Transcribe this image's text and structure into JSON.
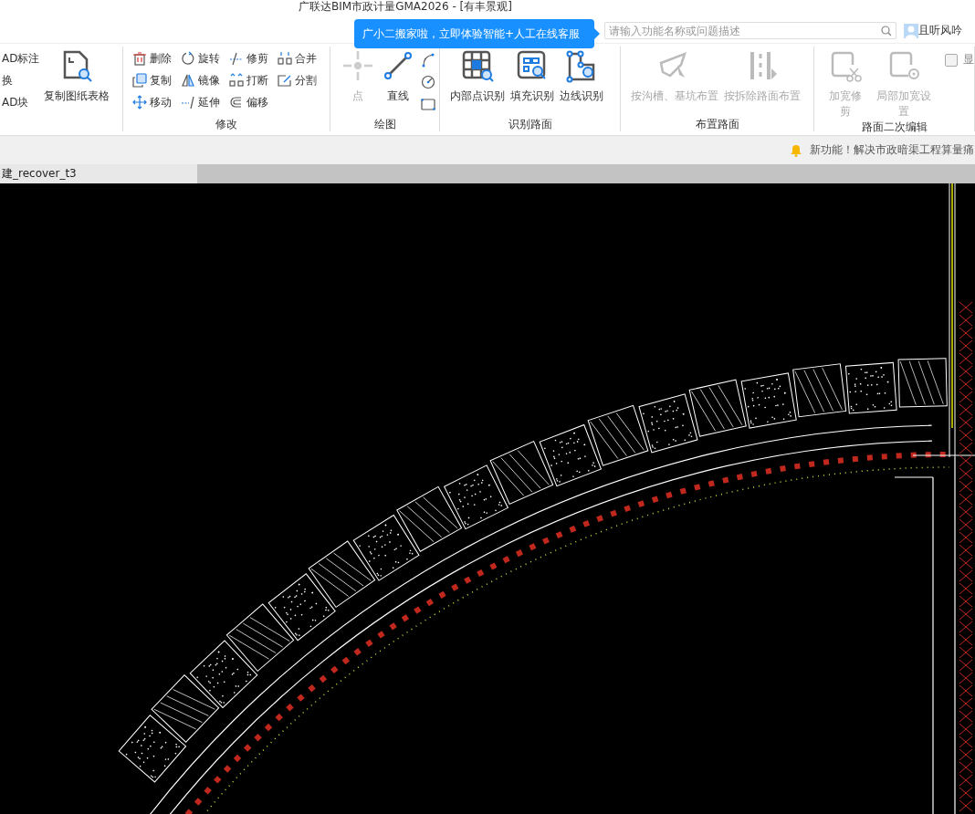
{
  "window": {
    "title": "广联达BIM市政计量GMA2026 - [有丰景观]"
  },
  "tooltip": {
    "text": "广小二搬家啦，立即体验智能+人工在线客服"
  },
  "search": {
    "placeholder": "请输入功能名称或问题描述"
  },
  "user": {
    "name": "且听风吟"
  },
  "ribbon": {
    "groups": [
      {
        "items": [
          {
            "kind": "small",
            "label": "AD标注",
            "disabled": false
          },
          {
            "kind": "small",
            "label": "换",
            "disabled": false
          },
          {
            "kind": "small",
            "label": "AD块",
            "disabled": false
          },
          {
            "kind": "big",
            "label": "复制图纸表格",
            "disabled": false
          }
        ]
      },
      {
        "label": "修改",
        "items": [
          {
            "kind": "small",
            "label": "删除",
            "disabled": false
          },
          {
            "kind": "small",
            "label": "复制",
            "disabled": false
          },
          {
            "kind": "small",
            "label": "移动",
            "disabled": false
          },
          {
            "kind": "small",
            "label": "旋转",
            "disabled": false
          },
          {
            "kind": "small",
            "label": "镜像",
            "disabled": false
          },
          {
            "kind": "small",
            "label": "延伸",
            "disabled": false
          },
          {
            "kind": "small",
            "label": "修剪",
            "disabled": false
          },
          {
            "kind": "small",
            "label": "打断",
            "disabled": false
          },
          {
            "kind": "small",
            "label": "偏移",
            "disabled": false
          },
          {
            "kind": "small",
            "label": "合并",
            "disabled": false
          },
          {
            "kind": "small",
            "label": "分割",
            "disabled": false
          }
        ]
      },
      {
        "label": "绘图",
        "items": [
          {
            "kind": "big",
            "label": "点",
            "disabled": true
          },
          {
            "kind": "big",
            "label": "直线",
            "disabled": false
          },
          {
            "kind": "icon",
            "disabled": false
          },
          {
            "kind": "icon",
            "disabled": false
          },
          {
            "kind": "icon",
            "disabled": false
          }
        ]
      },
      {
        "label": "识别路面",
        "items": [
          {
            "kind": "big",
            "label": "内部点识别",
            "disabled": false
          },
          {
            "kind": "big",
            "label": "填充识别",
            "disabled": false
          },
          {
            "kind": "big",
            "label": "边线识别",
            "disabled": false
          }
        ]
      },
      {
        "label": "布置路面",
        "items": [
          {
            "kind": "big",
            "label": "按沟槽、基坑布置",
            "disabled": true
          },
          {
            "kind": "big",
            "label": "按拆除路面布置",
            "disabled": true
          }
        ]
      },
      {
        "label": "路面二次编辑",
        "items": [
          {
            "kind": "big",
            "label": "加宽修剪",
            "disabled": true
          },
          {
            "kind": "big",
            "label": "局部加宽设置",
            "disabled": true
          },
          {
            "kind": "checkbox",
            "label": "显",
            "checked": false,
            "disabled": false
          }
        ]
      }
    ]
  },
  "notice": {
    "text": "新功能！解决市政暗渠工程算量痛"
  },
  "tabs": [
    {
      "label": "建_recover_t3",
      "selected": true
    }
  ]
}
